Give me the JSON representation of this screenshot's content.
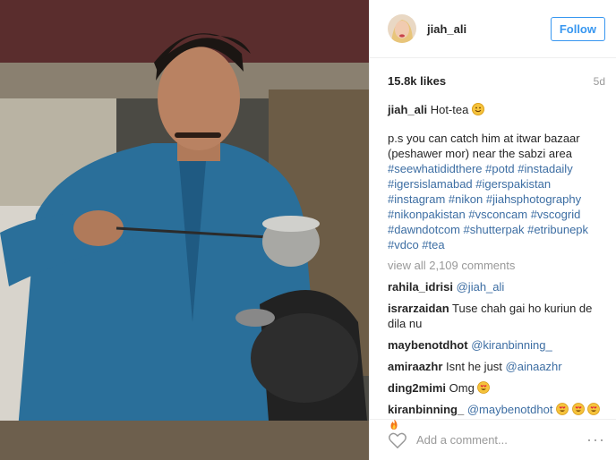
{
  "post": {
    "username": "jiah_ali",
    "follow_label": "Follow",
    "likes": "15.8k likes",
    "age": "5d"
  },
  "caption": {
    "username": "jiah_ali",
    "text": "Hot-tea",
    "line1": "p.s you can catch him at itwar bazaar (peshawer mor) near the sabzi area",
    "hashtags": "#seewhatididthere #potd #instadaily #igersislamabad #igerspakistan #instagram #nikon #jiahsphotography #nikonpakistan #vsconcam #vscogrid #dawndotcom #shutterpak #etribunepk #vdco #tea"
  },
  "view_all": "view all 2,109 comments",
  "comments": [
    {
      "user": "rahila_idrisi",
      "text": "",
      "mention": "@jiah_ali"
    },
    {
      "user": "israrzaidan",
      "text": "Tuse chah gai ho kuriun de dila nu",
      "mention": ""
    },
    {
      "user": "maybenotdhot",
      "text": "",
      "mention": "@kiranbinning_"
    },
    {
      "user": "amiraazhr",
      "text": "Isnt he just",
      "mention": "@ainaazhr"
    },
    {
      "user": "ding2mimi",
      "text": "Omg",
      "mention": ""
    },
    {
      "user": "kiranbinning_",
      "text": "",
      "mention": "@maybenotdhot"
    }
  ],
  "footer": {
    "placeholder": "Add a comment...",
    "more": "···"
  },
  "icons": {
    "heart": "heart-icon",
    "more": "more-options-icon",
    "emoji_smile": "smile-emoji-icon",
    "emoji_hearteyes": "heart-eyes-emoji-icon",
    "emoji_fire": "fire-emoji-icon"
  },
  "colors": {
    "accent": "#3897f0",
    "hashtag": "#3d6ea3",
    "shirt": "#2a6f9a"
  }
}
